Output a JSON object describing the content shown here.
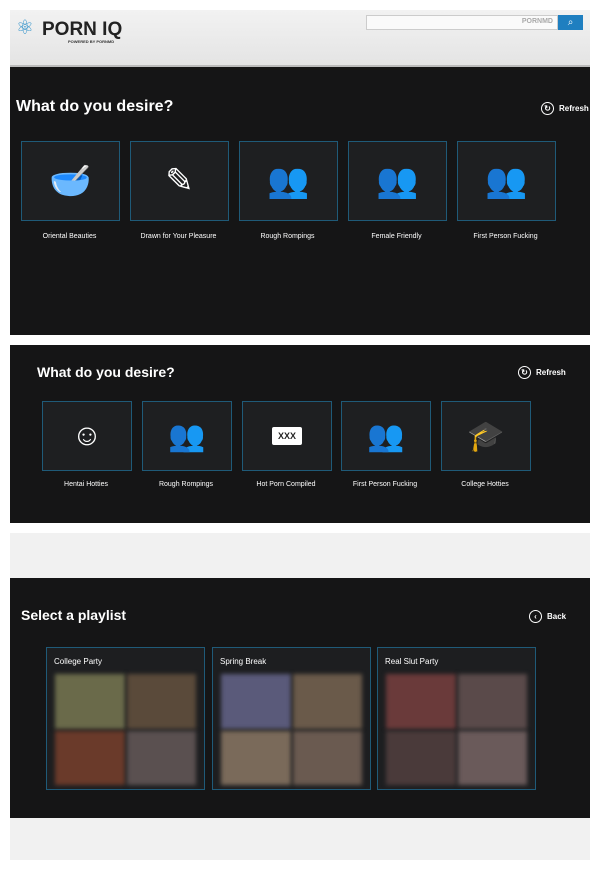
{
  "header": {
    "logo": "PORN IQ",
    "logo_sub": "POWERED BY PORNMD",
    "search_placeholder": "PORNMD",
    "search_icon": "search-icon"
  },
  "panel1": {
    "title": "What do you desire?",
    "refresh": "Refresh",
    "tiles": [
      {
        "label": "Oriental Beauties",
        "icon": "bowl-icon"
      },
      {
        "label": "Drawn for Your Pleasure",
        "icon": "pencil-icon"
      },
      {
        "label": "Rough Rompings",
        "icon": "figures-icon"
      },
      {
        "label": "Female Friendly",
        "icon": "couple-icon"
      },
      {
        "label": "First Person Fucking",
        "icon": "figures-icon"
      }
    ]
  },
  "panel2": {
    "title": "What do you desire?",
    "refresh": "Refresh",
    "tiles": [
      {
        "label": "Hentai Hotties",
        "icon": "face-icon"
      },
      {
        "label": "Rough Rompings",
        "icon": "figures-icon"
      },
      {
        "label": "Hot Porn Compiled",
        "icon": "folder-icon",
        "icon_text": "XXX"
      },
      {
        "label": "First Person Fucking",
        "icon": "figures-icon"
      },
      {
        "label": "College Hotties",
        "icon": "graduation-cap-icon"
      }
    ]
  },
  "panel3": {
    "title": "Select a playlist",
    "back": "Back",
    "playlists": [
      {
        "name": "College Party",
        "colors": [
          "#6a6a4a",
          "#5a4a3a",
          "#6a3a2a",
          "#5a5050"
        ]
      },
      {
        "name": "Spring Break",
        "colors": [
          "#5a5a7a",
          "#6a5a4a",
          "#7a6a5a",
          "#6a5a50"
        ]
      },
      {
        "name": "Real Slut Party",
        "colors": [
          "#6a3a3a",
          "#5a4a4a",
          "#4a3a3a",
          "#6a5a5a"
        ]
      }
    ]
  }
}
